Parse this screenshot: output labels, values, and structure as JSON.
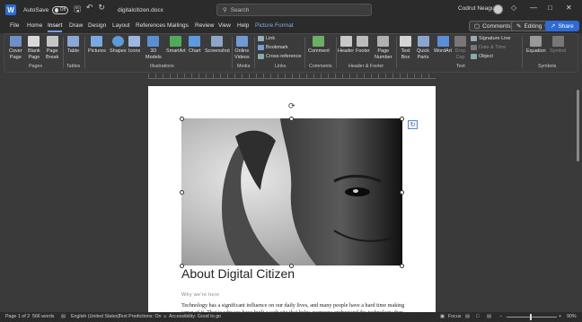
{
  "titlebar": {
    "app_logo": "W",
    "autosave_label": "AutoSave",
    "autosave_state": "Off",
    "undo_icon": "undo-icon",
    "redo_icon": "redo-icon",
    "doc_name": "digitalcitizen.docx",
    "search_placeholder": "Search",
    "user_name": "Codrut Neagu"
  },
  "tabs": [
    "File",
    "Home",
    "Insert",
    "Draw",
    "Design",
    "Layout",
    "References",
    "Mailings",
    "Review",
    "View",
    "Help",
    "Picture Format"
  ],
  "active_tab": "Insert",
  "tab_actions": {
    "comments": "Comments",
    "editing": "Editing",
    "share": "Share"
  },
  "ribbon": {
    "pages": {
      "cover": "Cover\nPage",
      "blank": "Blank\nPage",
      "break": "Page\nBreak",
      "group": "Pages"
    },
    "tables": {
      "table": "Table",
      "group": "Tables"
    },
    "illustrations": {
      "pictures": "Pictures",
      "shapes": "Shapes",
      "icons": "Icons",
      "models": "3D\nModels",
      "smartart": "SmartArt",
      "chart": "Chart",
      "screenshot": "Screenshot",
      "group": "Illustrations"
    },
    "media": {
      "video": "Online\nVideos",
      "group": "Media"
    },
    "links": {
      "link": "Link",
      "bookmark": "Bookmark",
      "cross": "Cross-reference",
      "group": "Links"
    },
    "comments": {
      "comment": "Comment",
      "group": "Comments"
    },
    "header_footer": {
      "header": "Header",
      "footer": "Footer",
      "page_number": "Page\nNumber",
      "group": "Header & Footer"
    },
    "text": {
      "textbox": "Text\nBox",
      "quickparts": "Quick\nParts",
      "wordart": "WordArt",
      "dropcap": "Drop\nCap",
      "signature": "Signature Line",
      "datetime": "Date & Time",
      "object": "Object",
      "group": "Text"
    },
    "symbols": {
      "equation": "Equation",
      "symbol": "Symbol",
      "group": "Symbols"
    }
  },
  "document": {
    "title": "About Digital Citizen",
    "subheading": "Why we're here",
    "body": "Technology has a significant influence on our daily lives, and many people have a hard time making sense of it. That is why we have built a web site that helps everyone understand the technology they use every day."
  },
  "statusbar": {
    "page": "Page 1 of 2",
    "words": "566 words",
    "language": "English (United States)",
    "predictions": "Text Predictions: On",
    "accessibility": "Accessibility: Good to go",
    "focus": "Focus",
    "zoom": "90%"
  },
  "colors": {
    "accent": "#2e6bd2",
    "titlebar": "#2b2b2b",
    "ribbon": "#3b3b3b",
    "canvas": "#3a3a3a"
  }
}
